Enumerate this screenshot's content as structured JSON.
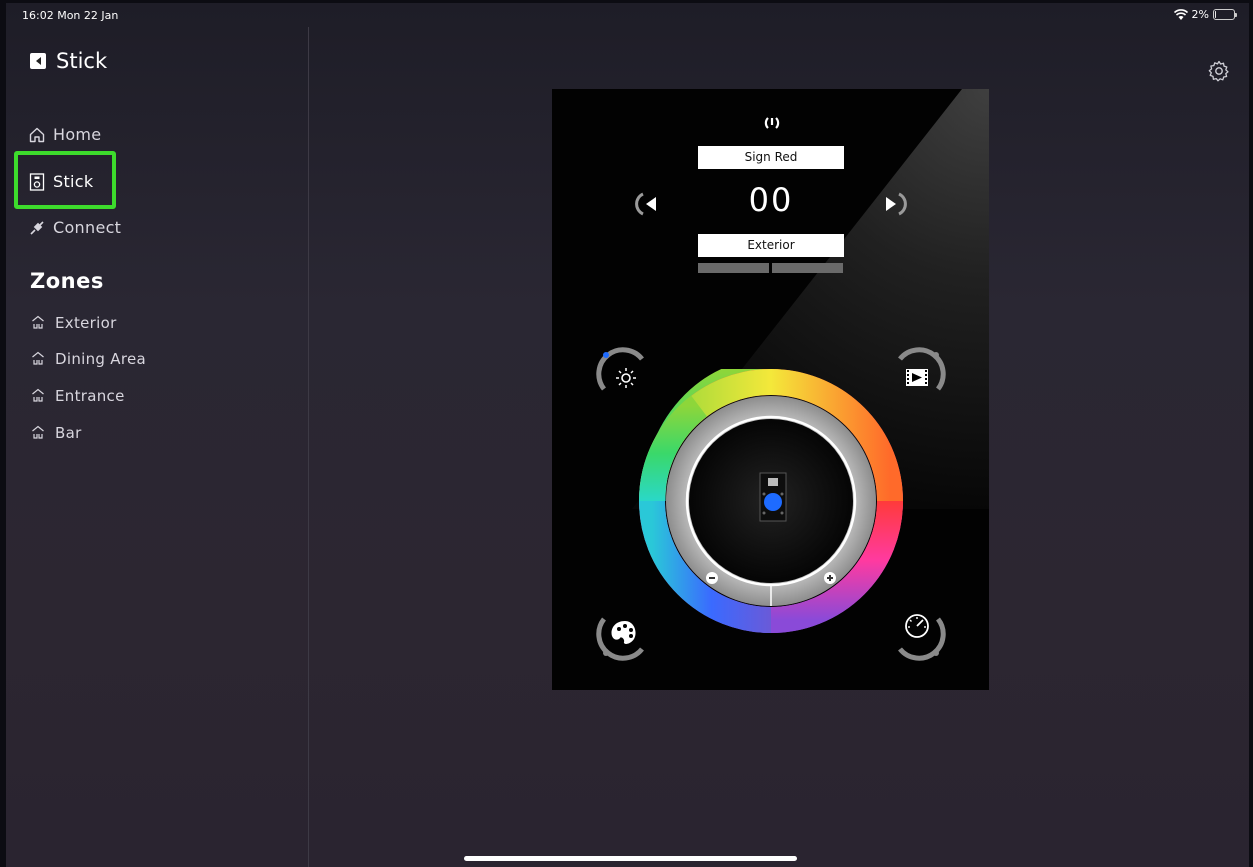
{
  "status_bar": {
    "time": "16:02  Mon 22 Jan",
    "battery_text": "2%",
    "battery_level": 0.02
  },
  "app": {
    "title": "Stick"
  },
  "nav": [
    {
      "label": "Home",
      "icon": "home-icon"
    },
    {
      "label": "Stick",
      "icon": "stick-icon",
      "selected": true
    },
    {
      "label": "Connect",
      "icon": "connect-icon"
    }
  ],
  "zones": {
    "title": "Zones",
    "items": [
      {
        "label": "Exterior",
        "icon": "zone-icon"
      },
      {
        "label": "Dining Area",
        "icon": "zone-icon"
      },
      {
        "label": "Entrance",
        "icon": "zone-icon"
      },
      {
        "label": "Bar",
        "icon": "zone-icon"
      }
    ]
  },
  "controller": {
    "scene_name": "Sign Red",
    "scene_number": "00",
    "zone_name": "Exterior",
    "icons": [
      "power-icon",
      "prev-icon",
      "next-icon",
      "brightness-icon",
      "film-icon",
      "palette-icon",
      "speed-icon",
      "minus-icon",
      "plus-icon"
    ]
  },
  "colors": {
    "highlight": "#3ddc2c",
    "accent_blue": "#1e6bff",
    "panel_bg": "#020202"
  }
}
